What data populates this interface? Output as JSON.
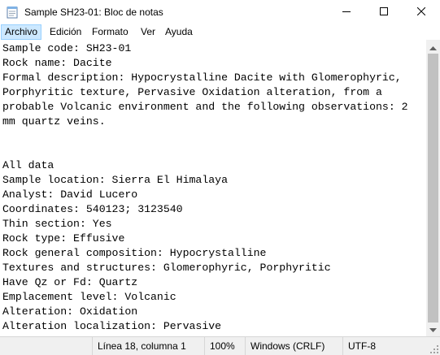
{
  "window": {
    "title": "Sample SH23-01: Bloc de notas"
  },
  "menu": [
    "Archivo",
    "Edición",
    "Formato",
    "Ver",
    "Ayuda"
  ],
  "document": {
    "lines": [
      "Sample code: SH23-01",
      "Rock name: Dacite",
      "Formal description: Hypocrystalline Dacite with Glomerophyric,",
      "Porphyritic texture, Pervasive Oxidation alteration, from a",
      "probable Volcanic environment and the following observations: 2",
      "mm quartz veins.",
      "",
      "",
      "All data",
      "Sample location: Sierra El Himalaya",
      "Analyst: David Lucero",
      "Coordinates: 540123; 3123540",
      "Thin section: Yes",
      "Rock type: Effusive",
      "Rock general composition: Hypocrystalline",
      "Textures and structures: Glomerophyric, Porphyritic",
      "Have Qz or Fd: Quartz",
      "Emplacement level: Volcanic",
      "Alteration: Oxidation",
      "Alteration localization: Pervasive"
    ]
  },
  "status": {
    "position": "Línea 18, columna 1",
    "zoom": "100%",
    "line_endings": "Windows (CRLF)",
    "encoding": "UTF-8"
  },
  "icons": {
    "app": "notepad-icon",
    "minimize": "minimize-icon",
    "maximize": "maximize-icon",
    "close": "close-icon",
    "scroll_up": "scroll-up-arrow-icon",
    "scroll_down": "scroll-down-arrow-icon"
  }
}
